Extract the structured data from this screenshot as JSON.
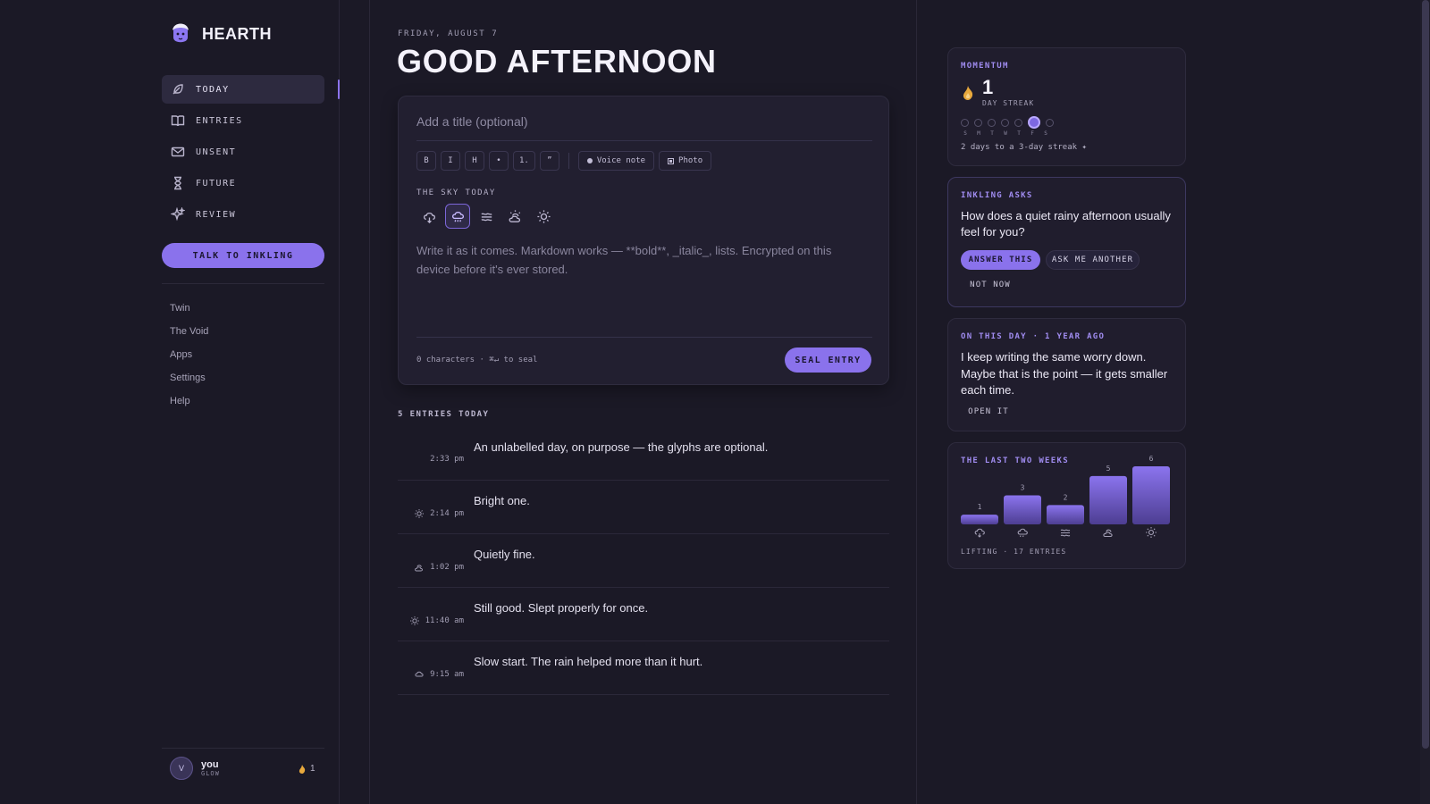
{
  "brand": {
    "name": "HEARTH"
  },
  "nav": [
    {
      "label": "TODAY",
      "icon": "feather-icon",
      "active": true
    },
    {
      "label": "ENTRIES",
      "icon": "book-icon"
    },
    {
      "label": "UNSENT",
      "icon": "envelope-icon"
    },
    {
      "label": "FUTURE",
      "icon": "hourglass-icon"
    },
    {
      "label": "REVIEW",
      "icon": "sparkle-icon"
    }
  ],
  "talk_button": "TALK TO INKLING",
  "secondary_links": [
    "Twin",
    "The Void",
    "Apps",
    "Settings",
    "Help"
  ],
  "user": {
    "initial": "V",
    "name": "you",
    "status": "GLOW",
    "streak": "1"
  },
  "header": {
    "date": "FRIDAY, AUGUST 7",
    "greeting": "GOOD AFTERNOON"
  },
  "editor": {
    "title_placeholder": "Add a title (optional)",
    "toolbar": [
      "B",
      "I",
      "H",
      "•",
      "1.",
      "”"
    ],
    "voice_note": "Voice note",
    "photo": "Photo",
    "sky_label": "THE SKY TODAY",
    "sky_options": [
      "rain",
      "drizzle",
      "fog",
      "partly-cloudy",
      "sun"
    ],
    "sky_selected": "drizzle",
    "body_placeholder": "Write it as it comes. Markdown works — **bold**, _italic_, lists. Encrypted on this device before it's ever stored.",
    "char_count": "0 characters · ⌘↵ to seal",
    "seal_label": "SEAL ENTRY"
  },
  "entries_label": "5 ENTRIES TODAY",
  "entries": [
    {
      "time": "2:33 pm",
      "sky": "",
      "text": "An unlabelled day, on purpose — the glyphs are optional."
    },
    {
      "time": "2:14 pm",
      "sky": "sun",
      "text": "Bright one."
    },
    {
      "time": "1:02 pm",
      "sky": "partly-cloudy",
      "text": "Quietly fine."
    },
    {
      "time": "11:40 am",
      "sky": "sun",
      "text": "Still good. Slept properly for once."
    },
    {
      "time": "9:15 am",
      "sky": "drizzle",
      "text": "Slow start. The rain helped more than it hurt."
    }
  ],
  "momentum": {
    "title": "MOMENTUM",
    "streak": "1",
    "streak_label": "DAY STREAK",
    "week_letters": [
      "S",
      "M",
      "T",
      "W",
      "T",
      "F",
      "S"
    ],
    "today_index": 5,
    "note": "2 days to a 3-day streak ✦"
  },
  "inkling": {
    "title": "INKLING ASKS",
    "question": "How does a quiet rainy afternoon usually feel for you?",
    "answer": "ANSWER THIS",
    "another": "ASK ME ANOTHER",
    "not_now": "NOT NOW"
  },
  "on_this_day": {
    "title": "ON THIS DAY · 1 YEAR AGO",
    "text": "I keep writing the same worry down. Maybe that is the point — it gets smaller each time.",
    "open": "OPEN IT"
  },
  "two_weeks": {
    "title": "THE LAST TWO WEEKS",
    "footer": "LIFTING · 17 ENTRIES"
  },
  "chart_data": {
    "type": "bar",
    "categories": [
      "rain",
      "drizzle",
      "fog",
      "partly-cloudy",
      "sun"
    ],
    "values": [
      1,
      3,
      2,
      5,
      6
    ],
    "title": "THE LAST TWO WEEKS"
  },
  "colors": {
    "accent": "#8a72ec",
    "background": "#1b1926",
    "card": "#201d2d"
  }
}
